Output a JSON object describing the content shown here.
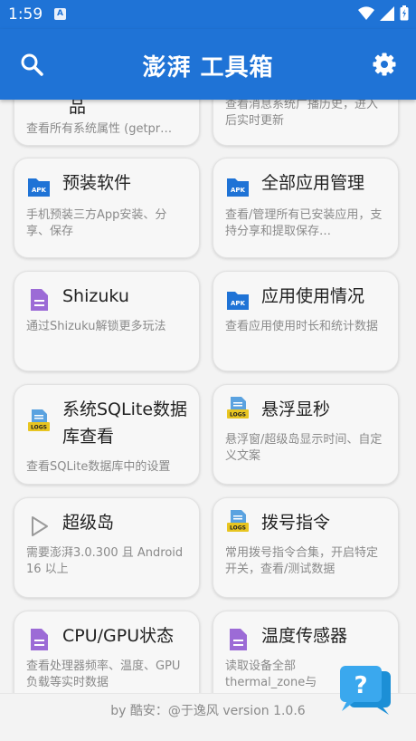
{
  "status_bar": {
    "time": "1:59",
    "notif_letter": "A"
  },
  "app_bar": {
    "title": "澎湃 工具箱"
  },
  "cards": [
    {
      "title": "品",
      "desc": "查看所有系统属性 (getpr…",
      "icon": "doc-icon"
    },
    {
      "title": "",
      "desc": "查看消息系统广播历史，进入后实时更新",
      "icon": ""
    },
    {
      "title": "预装软件",
      "desc": "手机预装三方App安装、分享、保存",
      "icon": "apk-folder-icon"
    },
    {
      "title": "全部应用管理",
      "desc": "查看/管理所有已安装应用，支持分享和提取保存…",
      "icon": "apk-folder-icon"
    },
    {
      "title": "Shizuku",
      "desc": "通过Shizuku解锁更多玩法",
      "icon": "doc-icon"
    },
    {
      "title": "应用使用情况",
      "desc": "查看应用使用时长和统计数据",
      "icon": "apk-folder-icon"
    },
    {
      "title": "系统SQLite数据库查看",
      "desc": "查看SQLite数据库中的设置",
      "icon": "logs-icon"
    },
    {
      "title": "悬浮显秒",
      "desc": "悬浮窗/超级岛显示时间、自定义文案",
      "icon": "logs-icon"
    },
    {
      "title": "超级岛",
      "desc": "需要澎湃3.0.300 且 Android 16 以上",
      "icon": "play-icon"
    },
    {
      "title": "拨号指令",
      "desc": "常用拨号指令合集，开启特定开关，查看/测试数据",
      "icon": "logs-icon"
    },
    {
      "title": "CPU/GPU状态",
      "desc": "查看处理器频率、温度、GPU负载等实时数据",
      "icon": "doc-icon"
    },
    {
      "title": "温度传感器",
      "desc": "读取设备全部thermal_zone与hw…",
      "icon": "doc-icon"
    }
  ],
  "icon_texts": {
    "apk": "APK",
    "logs": "LOGS"
  },
  "footer": {
    "credit": "by 酷安：@于逸风 version 1.0.6"
  },
  "colors": {
    "primary": "#1f73d6",
    "doc": "#9c6bd6",
    "apk": "#1f73d6",
    "logs": "#e8c521"
  }
}
